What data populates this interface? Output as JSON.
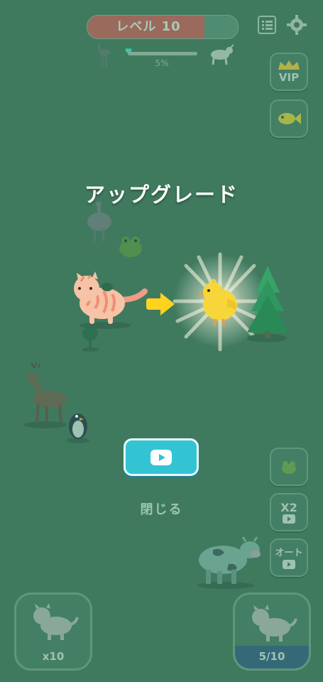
{
  "top": {
    "level_label": "レベル 10",
    "level_progress": 0.78,
    "progress_percent_label": "5%",
    "list_icon": "list-icon",
    "settings_icon": "gear-icon",
    "left_animal_icon": "flamingo-icon",
    "right_animal_icon": "goat-icon"
  },
  "side": {
    "vip_label": "VIP",
    "fish_icon": "fish-icon",
    "frog_icon": "frog-icon",
    "x2_label": "X2",
    "auto_label": "オート"
  },
  "center": {
    "title": "アップグレード",
    "from_animal": "cat",
    "to_animal": "chick",
    "close_label": "閉じる"
  },
  "bottom": {
    "left_card_label": "x10",
    "right_card_label": "5/10",
    "right_card_progress": 0.5
  },
  "colors": {
    "background": "#3f7a5e",
    "play_button": "#33c4d4",
    "arrow": "#ffd21f",
    "chick": "#f6d63a"
  }
}
